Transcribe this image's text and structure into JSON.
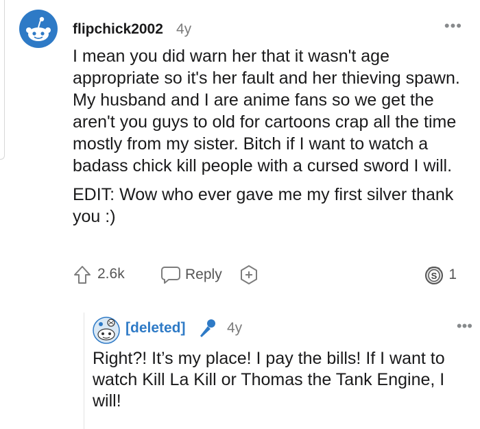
{
  "comment": {
    "author": "flipchick2002",
    "age": "4y",
    "more_icon": "more-dots-icon",
    "paragraphs": [
      "I mean you did warn her that it wasn't age appropriate so it's her fault and her thieving spawn. My husband and I are anime fans so we get the aren't you guys to old for cartoons crap all the time mostly from my sister. Bitch if I want to watch a badass chick kill people with a cursed sword I will.",
      "EDIT: Wow who ever gave me my first silver thank you :)"
    ],
    "score": "2.6k",
    "reply_label": "Reply",
    "silver_count": "1",
    "colors": {
      "avatar_bg": "#2e7ac6",
      "text": "#1a1a1b",
      "meta": "#7c7c7c"
    }
  },
  "reply": {
    "author": "[deleted]",
    "age": "4y",
    "more_icon": "more-dots-icon",
    "text": "Right?! It’s my place! I pay the bills! If I want to watch Kill La Kill or Thomas the Tank Engine, I will!",
    "colors": {
      "author": "#2e7ac6"
    }
  }
}
